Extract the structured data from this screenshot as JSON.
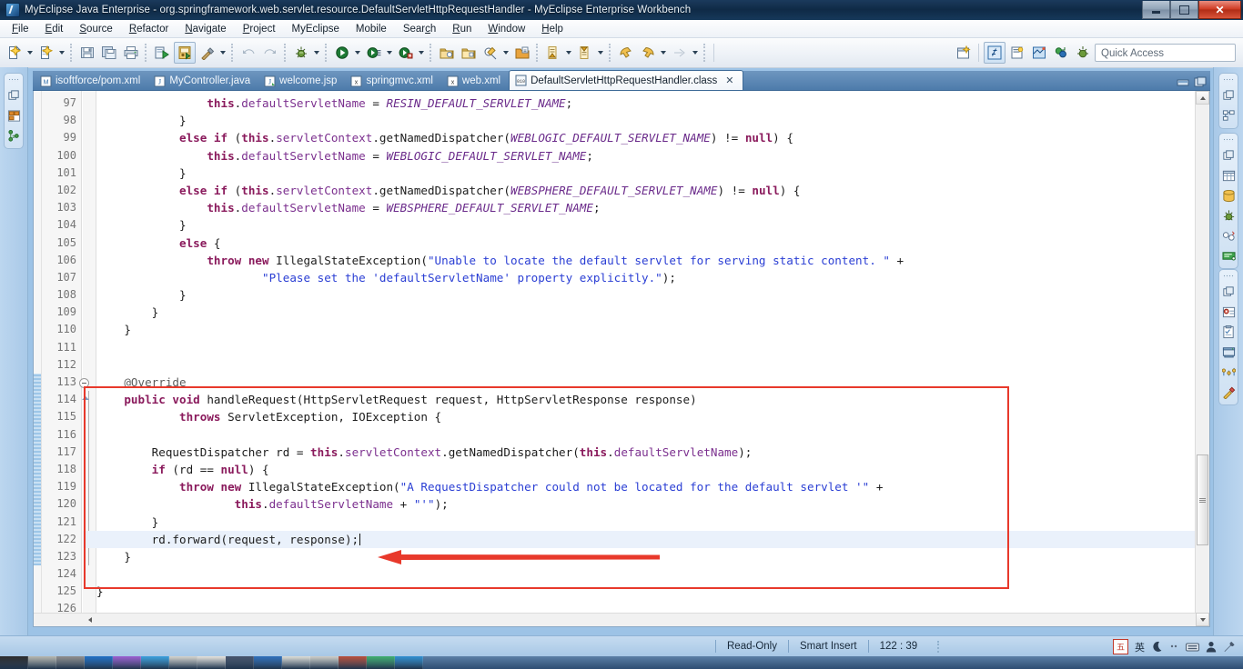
{
  "window": {
    "title": "MyEclipse Java Enterprise - org.springframework.web.servlet.resource.DefaultServletHttpRequestHandler - MyEclipse Enterprise Workbench",
    "app_icon": "myeclipse-icon",
    "minimize_label": "Minimize",
    "maximize_label": "Restore",
    "close_label": "Close"
  },
  "menubar": {
    "items": [
      {
        "label": "File",
        "mnemonic": "F"
      },
      {
        "label": "Edit",
        "mnemonic": "E"
      },
      {
        "label": "Source",
        "mnemonic": "S"
      },
      {
        "label": "Refactor",
        "mnemonic": "R"
      },
      {
        "label": "Navigate",
        "mnemonic": "N"
      },
      {
        "label": "Project",
        "mnemonic": "P"
      },
      {
        "label": "MyEclipse",
        "mnemonic": ""
      },
      {
        "label": "Mobile",
        "mnemonic": ""
      },
      {
        "label": "Search",
        "mnemonic": "c"
      },
      {
        "label": "Run",
        "mnemonic": "R"
      },
      {
        "label": "Window",
        "mnemonic": "W"
      },
      {
        "label": "Help",
        "mnemonic": "H"
      }
    ]
  },
  "toolbar": {
    "quick_access_placeholder": "Quick Access",
    "buttons": [
      {
        "name": "new-wizard-icon",
        "has_dropdown": true
      },
      {
        "name": "new-java-class-icon",
        "has_dropdown": true
      },
      {
        "name": "save-icon",
        "has_dropdown": false
      },
      {
        "name": "save-all-icon",
        "has_dropdown": false
      },
      {
        "name": "print-icon",
        "has_dropdown": false
      },
      {
        "name": "deploy-icon",
        "has_dropdown": false
      },
      {
        "name": "run-server-icon",
        "has_dropdown": false,
        "framed": true
      },
      {
        "name": "build-hammer-icon",
        "has_dropdown": true
      },
      {
        "name": "undo-icon",
        "has_dropdown": false
      },
      {
        "name": "redo-icon",
        "has_dropdown": false
      },
      {
        "name": "debug-icon",
        "has_dropdown": true
      },
      {
        "name": "run-icon",
        "has_dropdown": true
      },
      {
        "name": "run-external-icon",
        "has_dropdown": true
      },
      {
        "name": "profile-icon",
        "has_dropdown": true
      },
      {
        "name": "open-type-icon",
        "has_dropdown": false
      },
      {
        "name": "open-resource-icon",
        "has_dropdown": false
      },
      {
        "name": "search-pencil-icon",
        "has_dropdown": true
      },
      {
        "name": "open-task-icon",
        "has_dropdown": false
      },
      {
        "name": "next-annotation-icon",
        "has_dropdown": true
      },
      {
        "name": "previous-annotation-icon",
        "has_dropdown": true
      },
      {
        "name": "back-icon",
        "has_dropdown": false
      },
      {
        "name": "forward-icon",
        "has_dropdown": true
      },
      {
        "name": "next-edit-icon",
        "has_dropdown": true
      }
    ],
    "perspective_buttons": [
      {
        "name": "open-perspective-icon"
      },
      {
        "name": "myeclipse-java-enterprise-perspective-icon",
        "active": true
      },
      {
        "name": "java-perspective-icon"
      },
      {
        "name": "java-ee-perspective-icon"
      },
      {
        "name": "team-synchronizing-perspective-icon"
      },
      {
        "name": "debug-perspective-icon"
      }
    ]
  },
  "left_dock": {
    "icons": [
      {
        "name": "restore-view-icon"
      },
      {
        "name": "package-explorer-icon"
      },
      {
        "name": "outline-view-icon"
      }
    ]
  },
  "right_dock": {
    "groups": [
      {
        "icons": [
          {
            "name": "restore-view-icon"
          },
          {
            "name": "outline-tree-icon"
          }
        ]
      },
      {
        "icons": [
          {
            "name": "restore-view-icon"
          },
          {
            "name": "database-table-icon"
          },
          {
            "name": "db-browser-icon"
          },
          {
            "name": "debug-bug-icon"
          },
          {
            "name": "breakpoints-icon"
          },
          {
            "name": "console-icon"
          }
        ]
      },
      {
        "icons": [
          {
            "name": "restore-view-icon"
          },
          {
            "name": "problems-view-icon"
          },
          {
            "name": "tasks-view-icon"
          },
          {
            "name": "servers-view-icon"
          },
          {
            "name": "properties-view-icon"
          },
          {
            "name": "snippets-view-icon"
          }
        ]
      }
    ]
  },
  "editor": {
    "tabs": [
      {
        "label": "isoftforce/pom.xml",
        "icon": "maven-pom-icon",
        "active": false,
        "closable": false
      },
      {
        "label": "MyController.java",
        "icon": "java-file-icon",
        "active": false,
        "closable": false
      },
      {
        "label": "welcome.jsp",
        "icon": "jsp-file-icon",
        "active": false,
        "closable": false
      },
      {
        "label": "springmvc.xml",
        "icon": "xml-file-icon",
        "active": false,
        "closable": false
      },
      {
        "label": "web.xml",
        "icon": "xml-file-icon",
        "active": false,
        "closable": false
      },
      {
        "label": "DefaultServletHttpRequestHandler.class",
        "icon": "class-file-icon",
        "active": true,
        "closable": true
      }
    ],
    "panel_buttons": [
      {
        "name": "minimize-editor-icon"
      },
      {
        "name": "maximize-editor-icon"
      }
    ],
    "first_line": 97,
    "current_line": 122,
    "highlight_from": 113,
    "highlight_to": 123,
    "lines": [
      {
        "n": 97,
        "html": "                <span class=\"kw\">this</span>.<span class=\"fld\">defaultServletName</span> = <span class=\"sfld\">RESIN_DEFAULT_SERVLET_NAME</span>;"
      },
      {
        "n": 98,
        "html": "            }"
      },
      {
        "n": 99,
        "html": "            <span class=\"kw\">else if</span> (<span class=\"kw\">this</span>.<span class=\"fld\">servletContext</span>.getNamedDispatcher(<span class=\"sfld\">WEBLOGIC_DEFAULT_SERVLET_NAME</span>) != <span class=\"kw\">null</span>) {"
      },
      {
        "n": 100,
        "html": "                <span class=\"kw\">this</span>.<span class=\"fld\">defaultServletName</span> = <span class=\"sfld\">WEBLOGIC_DEFAULT_SERVLET_NAME</span>;"
      },
      {
        "n": 101,
        "html": "            }"
      },
      {
        "n": 102,
        "html": "            <span class=\"kw\">else if</span> (<span class=\"kw\">this</span>.<span class=\"fld\">servletContext</span>.getNamedDispatcher(<span class=\"sfld\">WEBSPHERE_DEFAULT_SERVLET_NAME</span>) != <span class=\"kw\">null</span>) {"
      },
      {
        "n": 103,
        "html": "                <span class=\"kw\">this</span>.<span class=\"fld\">defaultServletName</span> = <span class=\"sfld\">WEBSPHERE_DEFAULT_SERVLET_NAME</span>;"
      },
      {
        "n": 104,
        "html": "            }"
      },
      {
        "n": 105,
        "html": "            <span class=\"kw\">else</span> {"
      },
      {
        "n": 106,
        "html": "                <span class=\"kw\">throw new</span> IllegalStateException(<span class=\"str\">\"Unable to locate the default servlet for serving static content. \"</span> +"
      },
      {
        "n": 107,
        "html": "                        <span class=\"str\">\"Please set the 'defaultServletName' property explicitly.\"</span>);"
      },
      {
        "n": 108,
        "html": "            }"
      },
      {
        "n": 109,
        "html": "        }"
      },
      {
        "n": 110,
        "html": "    }"
      },
      {
        "n": 111,
        "html": ""
      },
      {
        "n": 112,
        "html": ""
      },
      {
        "n": 113,
        "html": "    <span class=\"anno\">@Override</span>"
      },
      {
        "n": 114,
        "html": "    <span class=\"kw\">public void</span> handleRequest(HttpServletRequest request, HttpServletResponse response)"
      },
      {
        "n": 115,
        "html": "            <span class=\"kw\">throws</span> ServletException, IOException {"
      },
      {
        "n": 116,
        "html": ""
      },
      {
        "n": 117,
        "html": "        RequestDispatcher rd = <span class=\"kw\">this</span>.<span class=\"fld\">servletContext</span>.getNamedDispatcher(<span class=\"kw\">this</span>.<span class=\"fld\">defaultServletName</span>);"
      },
      {
        "n": 118,
        "html": "        <span class=\"kw\">if</span> (rd == <span class=\"kw\">null</span>) {"
      },
      {
        "n": 119,
        "html": "            <span class=\"kw\">throw new</span> IllegalStateException(<span class=\"str\">\"A RequestDispatcher could not be located for the default servlet '\"</span> +"
      },
      {
        "n": 120,
        "html": "                    <span class=\"kw\">this</span>.<span class=\"fld\">defaultServletName</span> + <span class=\"str\">\"'\"</span>);"
      },
      {
        "n": 121,
        "html": "        }"
      },
      {
        "n": 122,
        "html": "        rd.forward(request, response);<span class=\"caret\"></span>"
      },
      {
        "n": 123,
        "html": "    }"
      },
      {
        "n": 124,
        "html": ""
      },
      {
        "n": 125,
        "html": "}"
      },
      {
        "n": 126,
        "html": ""
      }
    ]
  },
  "annotation": {
    "box_color": "#e8392b",
    "arrow_color": "#e8392b",
    "arrow_target_line": 122,
    "arrow_direction": "left"
  },
  "statusbar": {
    "read_only": "Read-Only",
    "insert_mode": "Smart Insert",
    "cursor_position": "122 : 39",
    "ime": {
      "mode_box": "五",
      "language": "英",
      "moon_icon": "moon-icon",
      "dots_icon": "dots-icon",
      "keyboard_icon": "keyboard-icon",
      "person_icon": "person-icon",
      "tools_icon": "tools-icon"
    }
  },
  "taskbar": {
    "items": [
      {
        "name": "taskbar-item-1",
        "color": "#2b2b2b"
      },
      {
        "name": "taskbar-item-2",
        "color": "#b7b7ae"
      },
      {
        "name": "taskbar-item-3",
        "color": "#8f8e8c"
      },
      {
        "name": "taskbar-item-4",
        "color": "#1f6fc4"
      },
      {
        "name": "taskbar-item-5",
        "color": "#9a5fd0"
      },
      {
        "name": "taskbar-item-6",
        "color": "#3aa0dd"
      },
      {
        "name": "taskbar-item-7",
        "color": "#d6d4cd"
      },
      {
        "name": "taskbar-item-8",
        "color": "#e6e3dc"
      },
      {
        "name": "taskbar-item-9",
        "color": "#46536a"
      },
      {
        "name": "taskbar-item-10",
        "color": "#2e6fba"
      },
      {
        "name": "taskbar-item-11",
        "color": "#ddddd6"
      },
      {
        "name": "taskbar-item-12",
        "color": "#cfcfc8"
      },
      {
        "name": "taskbar-item-13",
        "color": "#b94f3a"
      },
      {
        "name": "taskbar-item-14",
        "color": "#3fae6e"
      },
      {
        "name": "taskbar-item-15",
        "color": "#2f8fd0"
      }
    ]
  },
  "colors": {
    "title_bar": "#0f2a46",
    "tab_bar": "#4d7bab",
    "accent_red": "#e8392b",
    "keyword": "#8a1a5c",
    "string": "#2a3ed4",
    "field": "#7b2f8e",
    "chrome_blue": "#a9c9e8"
  }
}
